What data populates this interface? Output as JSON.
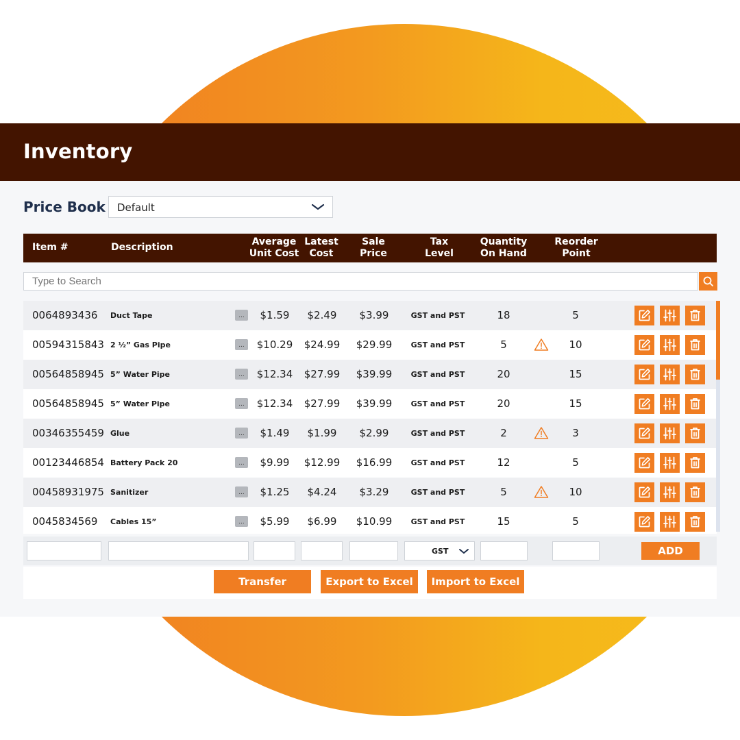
{
  "app": {
    "title": "Inventory"
  },
  "price_book": {
    "label": "Price Book",
    "selected": "Default"
  },
  "columns": {
    "item": "Item #",
    "description": "Description",
    "avg_cost_1": "Average",
    "avg_cost_2": "Unit Cost",
    "latest_cost_1": "Latest",
    "latest_cost_2": "Cost",
    "sale_price_1": "Sale",
    "sale_price_2": "Price",
    "tax_level_1": "Tax",
    "tax_level_2": "Level",
    "qty_1": "Quantity",
    "qty_2": "On Hand",
    "reorder_1": "Reorder",
    "reorder_2": "Point"
  },
  "search": {
    "placeholder": "Type to Search"
  },
  "rows": [
    {
      "item": "0064893436",
      "description": "Duct Tape",
      "more": "...",
      "avg_cost": "$1.59",
      "latest_cost": "$2.49",
      "sale_price": "$3.99",
      "tax_level": "GST and PST",
      "qty": "18",
      "reorder": "5",
      "warning": false
    },
    {
      "item": "00594315843",
      "description": "2 ½” Gas Pipe",
      "more": "...",
      "avg_cost": "$10.29",
      "latest_cost": "$24.99",
      "sale_price": "$29.99",
      "tax_level": "GST and PST",
      "qty": "5",
      "reorder": "10",
      "warning": true
    },
    {
      "item": "00564858945",
      "description": "5” Water Pipe",
      "more": "...",
      "avg_cost": "$12.34",
      "latest_cost": "$27.99",
      "sale_price": "$39.99",
      "tax_level": "GST and PST",
      "qty": "20",
      "reorder": "15",
      "warning": false
    },
    {
      "item": "00564858945",
      "description": "5” Water Pipe",
      "more": "...",
      "avg_cost": "$12.34",
      "latest_cost": "$27.99",
      "sale_price": "$39.99",
      "tax_level": "GST and PST",
      "qty": "20",
      "reorder": "15",
      "warning": false
    },
    {
      "item": "00346355459",
      "description": "Glue",
      "more": "...",
      "avg_cost": "$1.49",
      "latest_cost": "$1.99",
      "sale_price": "$2.99",
      "tax_level": "GST and PST",
      "qty": "2",
      "reorder": "3",
      "warning": true
    },
    {
      "item": "00123446854",
      "description": "Battery Pack 20",
      "more": "...",
      "avg_cost": "$9.99",
      "latest_cost": "$12.99",
      "sale_price": "$16.99",
      "tax_level": "GST and PST",
      "qty": "12",
      "reorder": "5",
      "warning": false
    },
    {
      "item": "00458931975",
      "description": "Sanitizer",
      "more": "...",
      "avg_cost": "$1.25",
      "latest_cost": "$4.24",
      "sale_price": "$3.29",
      "tax_level": "GST and PST",
      "qty": "5",
      "reorder": "10",
      "warning": true
    },
    {
      "item": "0045834569",
      "description": "Cables 15”",
      "more": "...",
      "avg_cost": "$5.99",
      "latest_cost": "$6.99",
      "sale_price": "$10.99",
      "tax_level": "GST and PST",
      "qty": "15",
      "reorder": "5",
      "warning": false
    }
  ],
  "row_icons": [
    "edit-icon",
    "adjust-icon",
    "delete-icon"
  ],
  "add_row": {
    "tax_selected": "GST",
    "add_label": "ADD"
  },
  "buttons": {
    "transfer": "Transfer",
    "export": "Export to Excel",
    "import": "Import to Excel"
  },
  "colors": {
    "header_bg": "#431400",
    "accent": "#f07d22",
    "warning": "#f07d22"
  }
}
